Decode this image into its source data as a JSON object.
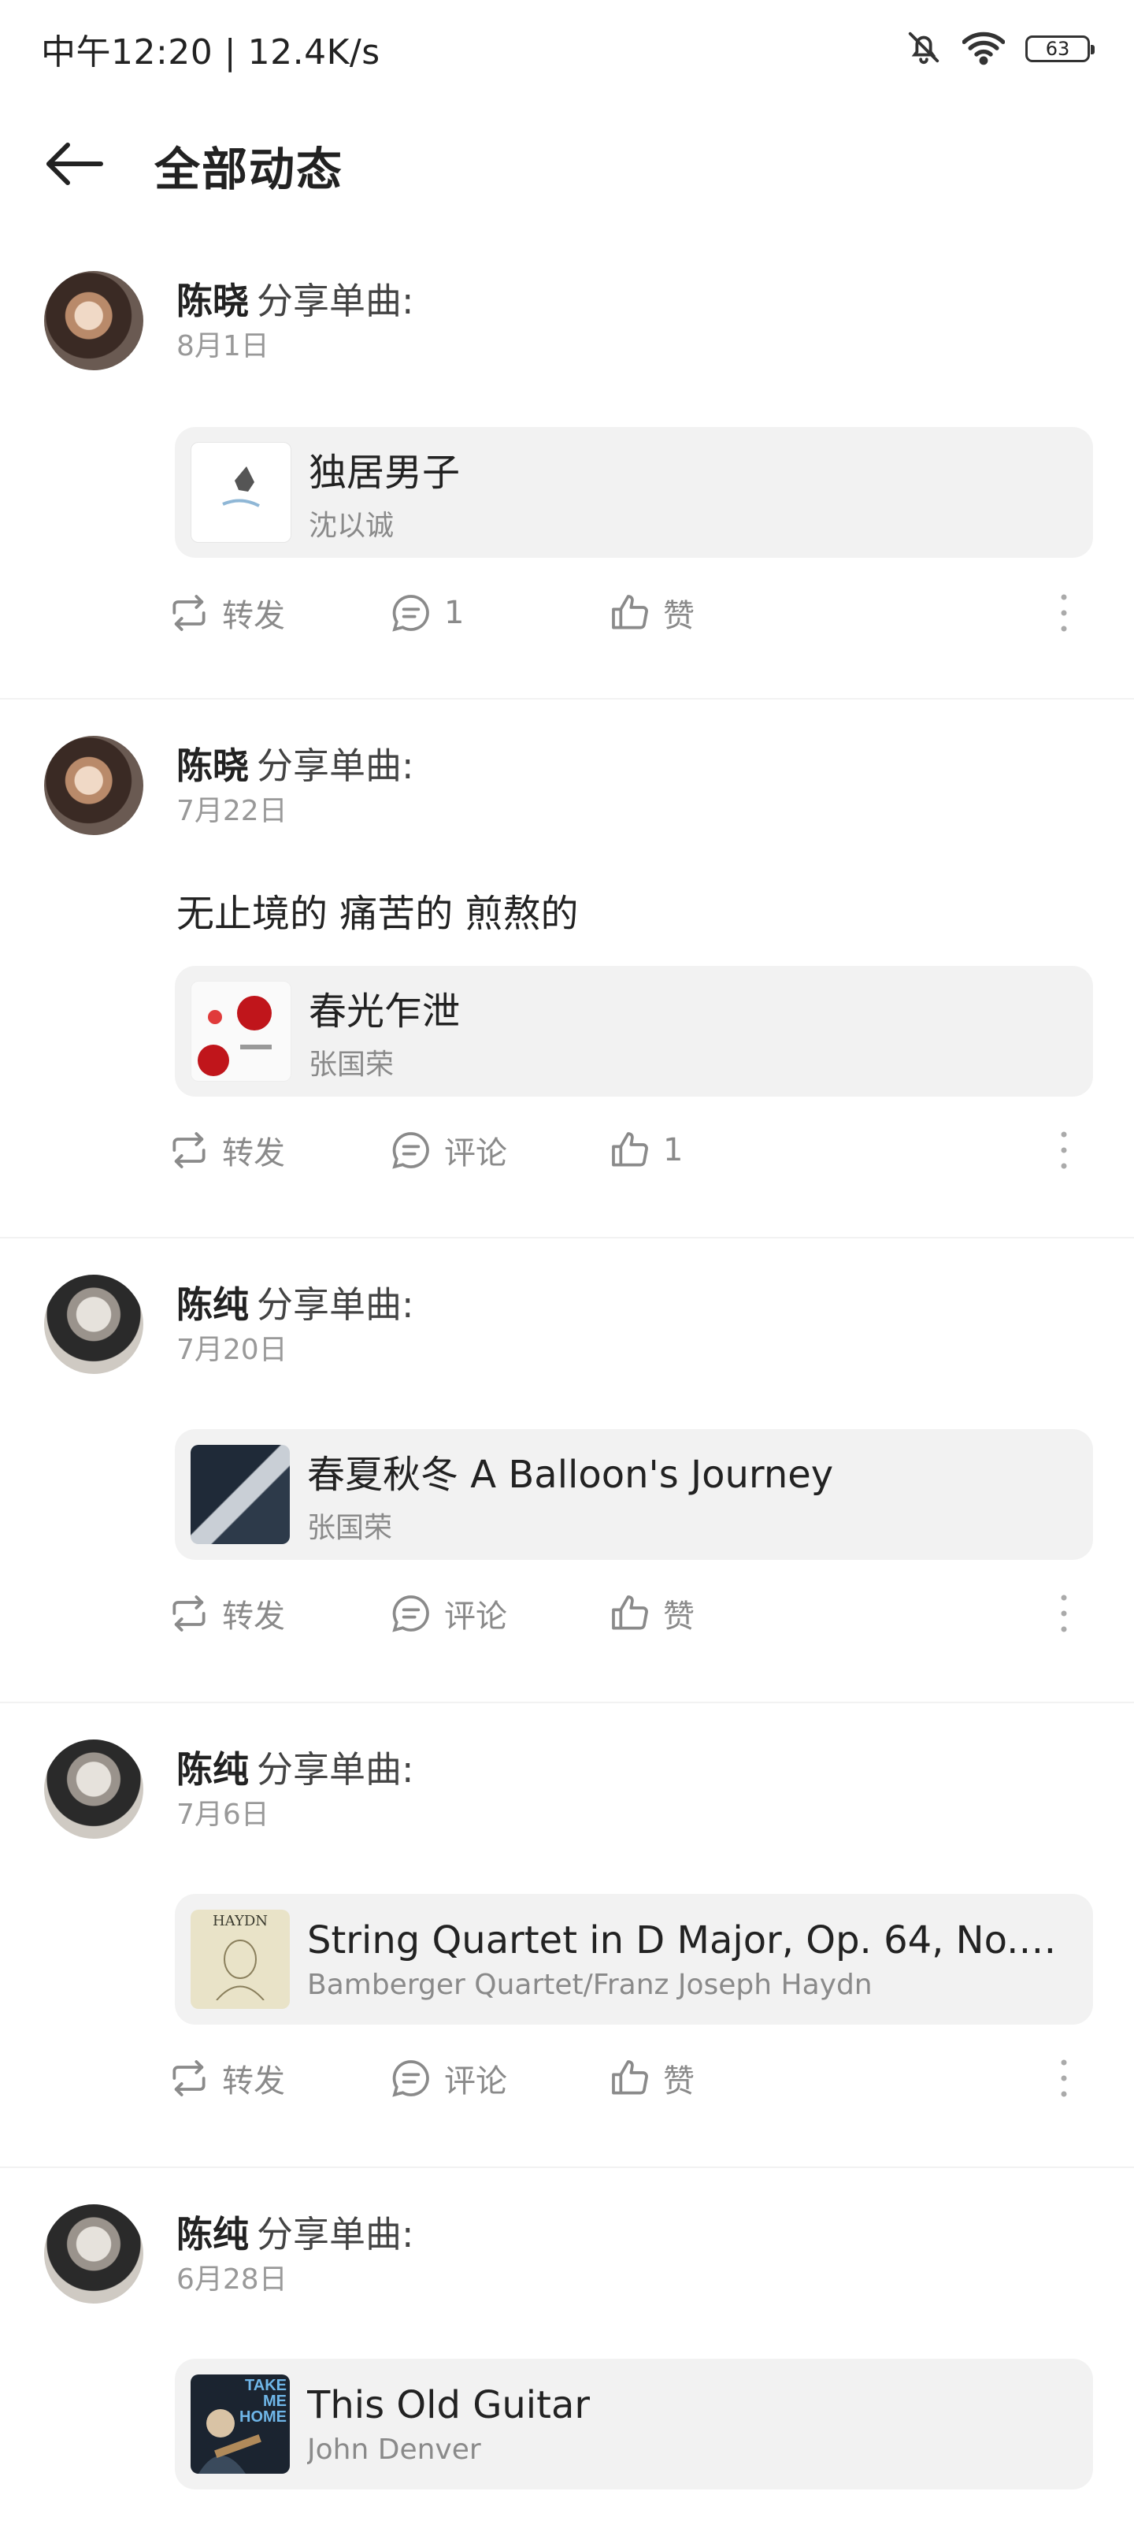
{
  "status_bar": {
    "time_speed": "中午12:20 | 12.4K/s",
    "battery": "63"
  },
  "header": {
    "title": "全部动态"
  },
  "posts": [
    {
      "author": "陈晓",
      "action": "分享单曲:",
      "date": "8月1日",
      "text": "",
      "song": {
        "title": "独居男子",
        "artist": "沈以诚"
      },
      "repost_label": "转发",
      "comment_label": "1",
      "like_label": "赞"
    },
    {
      "author": "陈晓",
      "action": "分享单曲:",
      "date": "7月22日",
      "text": "无止境的  痛苦的 煎熬的",
      "song": {
        "title": "春光乍泄",
        "artist": "张国荣"
      },
      "repost_label": "转发",
      "comment_label": "评论",
      "like_label": "1"
    },
    {
      "author": "陈纯",
      "action": "分享单曲:",
      "date": "7月20日",
      "text": "",
      "song": {
        "title": "春夏秋冬 A Balloon's Journey",
        "artist": "张国荣"
      },
      "repost_label": "转发",
      "comment_label": "评论",
      "like_label": "赞"
    },
    {
      "author": "陈纯",
      "action": "分享单曲:",
      "date": "7月6日",
      "text": "",
      "song": {
        "title": "String Quartet in D Major, Op. 64, No.…",
        "artist": "Bamberger Quartet/Franz Joseph Haydn",
        "cover_text": "HAYDN"
      },
      "repost_label": "转发",
      "comment_label": "评论",
      "like_label": "赞"
    },
    {
      "author": "陈纯",
      "action": "分享单曲:",
      "date": "6月28日",
      "text": "",
      "song": {
        "title": "This Old Guitar",
        "artist": "John Denver",
        "cover_text": "TAKE ME HOME"
      },
      "repost_label": "",
      "comment_label": "",
      "like_label": ""
    }
  ],
  "icons": {
    "back": "arrow-left-icon",
    "repost": "repost-icon",
    "comment": "comment-icon",
    "like": "thumbs-up-icon",
    "more": "more-vertical-icon",
    "mute": "bell-off-icon",
    "wifi": "wifi-icon"
  }
}
